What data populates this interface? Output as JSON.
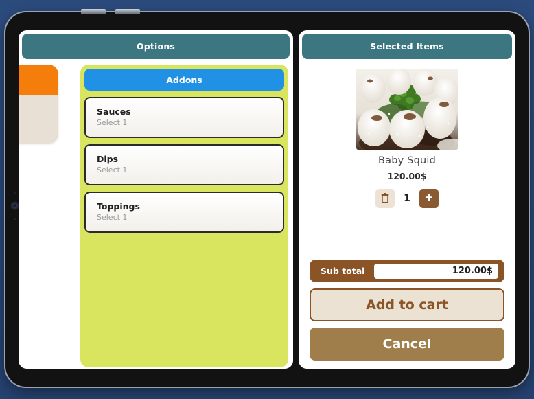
{
  "device": {
    "type": "tablet",
    "bezel_buttons": [
      "volume-up",
      "volume-down"
    ],
    "camera": "front-camera"
  },
  "options_panel": {
    "header_title": "Options",
    "previous_category": {
      "name": "",
      "header_color": "#f47d0b",
      "body_color": "#e8e0d4"
    },
    "active_tab": {
      "label": "Addons",
      "color": "#2091e4"
    },
    "panel_color": "#d9e55e",
    "addons": [
      {
        "title": "Sauces",
        "subtitle": "Select 1"
      },
      {
        "title": "Dips",
        "subtitle": "Select 1"
      },
      {
        "title": "Toppings",
        "subtitle": "Select 1"
      }
    ]
  },
  "selected_panel": {
    "header_title": "Selected Items",
    "item": {
      "image_alt": "baby-squid-dish",
      "name": "Baby Squid",
      "price": "120.00$",
      "quantity": "1",
      "delete_icon": "trash-icon",
      "add_icon": "plus-icon"
    },
    "subtotal": {
      "label": "Sub total",
      "value": "120.00$"
    },
    "buttons": {
      "add_to_cart": "Add to cart",
      "cancel": "Cancel"
    }
  },
  "colors": {
    "background": "#2a4a7c",
    "header_teal": "#3c7680",
    "accent_green": "#d9e55e",
    "accent_blue": "#2091e4",
    "accent_orange": "#f47d0b",
    "brown_dark": "#8a5426",
    "brown_light": "#a07e4c",
    "cream": "#ece2d3"
  }
}
